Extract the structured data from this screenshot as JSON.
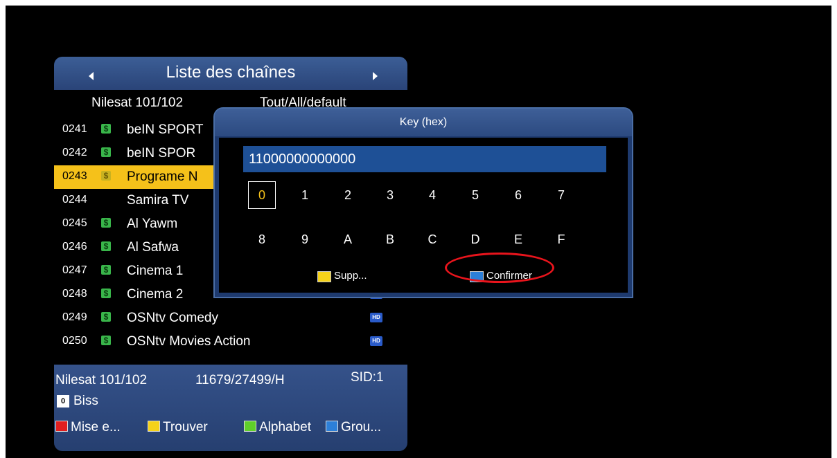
{
  "channel_list": {
    "title": "Liste des chaînes",
    "satellite": "Nilesat 101/102",
    "group": "Tout/All/default",
    "rows": [
      {
        "num": "0241",
        "name": "beIN SPORT",
        "scrambled": true,
        "hd": false
      },
      {
        "num": "0242",
        "name": "beIN SPOR",
        "scrambled": true,
        "hd": false
      },
      {
        "num": "0243",
        "name": "Programe N",
        "scrambled": true,
        "hd": false,
        "selected": true
      },
      {
        "num": "0244",
        "name": "Samira TV",
        "scrambled": false,
        "hd": false
      },
      {
        "num": "0245",
        "name": "Al Yawm",
        "scrambled": true,
        "hd": false
      },
      {
        "num": "0246",
        "name": "Al Safwa",
        "scrambled": true,
        "hd": false
      },
      {
        "num": "0247",
        "name": "Cinema 1",
        "scrambled": true,
        "hd": false
      },
      {
        "num": "0248",
        "name": "Cinema 2",
        "scrambled": true,
        "hd": true
      },
      {
        "num": "0249",
        "name": "OSNtv Comedy",
        "scrambled": true,
        "hd": true
      },
      {
        "num": "0250",
        "name": "OSNtv Movies Action",
        "scrambled": true,
        "hd": true
      }
    ],
    "footer": {
      "satellite": "Nilesat 101/102",
      "frequency": "11679/27499/H",
      "sid": "SID:1",
      "key_badge": "0",
      "biss": "Biss",
      "legend": [
        {
          "color": "#e01f1f",
          "label": "Mise e..."
        },
        {
          "color": "#f5d21a",
          "label": "Trouver"
        },
        {
          "color": "#5fcf2a",
          "label": "Alphabet"
        },
        {
          "color": "#2c7fd8",
          "label": "Grou..."
        }
      ]
    },
    "icons": {
      "scrambled": "dollar-icon",
      "hd": "HD"
    }
  },
  "key_dialog": {
    "title": "Key (hex)",
    "value": "11000000000000",
    "keys_row1": [
      "0",
      "1",
      "2",
      "3",
      "4",
      "5",
      "6",
      "7"
    ],
    "keys_row2": [
      "8",
      "9",
      "A",
      "B",
      "C",
      "D",
      "E",
      "F"
    ],
    "focused_key": "0",
    "delete_label": "Supp...",
    "confirm_label": "Confirmer",
    "delete_color": "#f5d21a",
    "confirm_color": "#2c7fd8"
  },
  "highlight_color": "#e8141c",
  "selection_color": "#f5c11a"
}
